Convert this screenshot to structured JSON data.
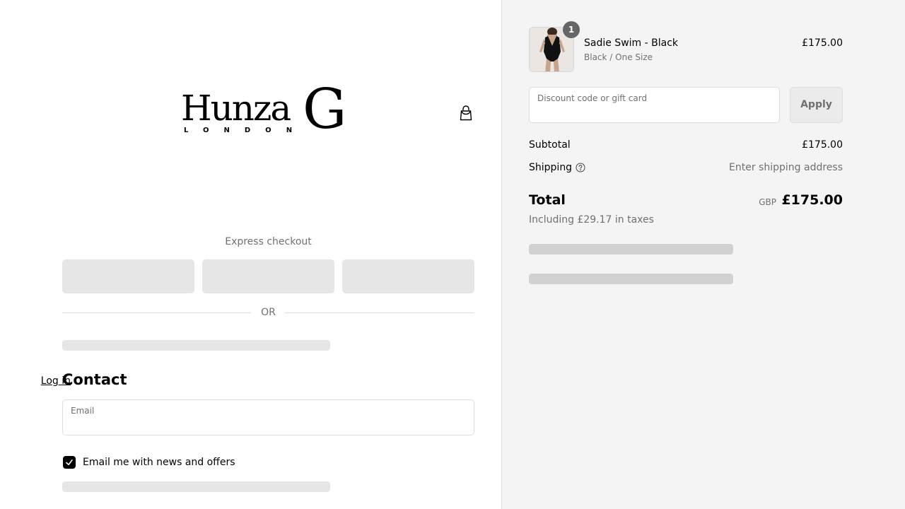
{
  "brand": {
    "name": "Hunza",
    "initial": "G",
    "tagline": "LONDON"
  },
  "icons": {
    "cart": "shopping-bag-icon",
    "help": "question-circle-icon",
    "check": "check-icon"
  },
  "express": {
    "label": "Express checkout",
    "divider": "OR"
  },
  "contact": {
    "title": "Contact",
    "login": "Log in",
    "email_label": "Email",
    "newsletter_label": "Email me with news and offers",
    "newsletter_checked": true
  },
  "order": {
    "item": {
      "quantity": "1",
      "name": "Sadie Swim - Black",
      "variant": "Black / One Size",
      "price": "£175.00"
    },
    "discount_placeholder": "Discount code or gift card",
    "apply_label": "Apply",
    "subtotal_label": "Subtotal",
    "subtotal_value": "£175.00",
    "shipping_label": "Shipping",
    "shipping_value": "Enter shipping address",
    "total_label": "Total",
    "currency": "GBP",
    "total_value": "£175.00",
    "taxes_note": "Including £29.17 in taxes"
  },
  "colors": {
    "accent": "#000000",
    "muted_text": "#707070",
    "sidebar_bg": "#f4f4f4",
    "skeleton": "#e6e6e6"
  }
}
